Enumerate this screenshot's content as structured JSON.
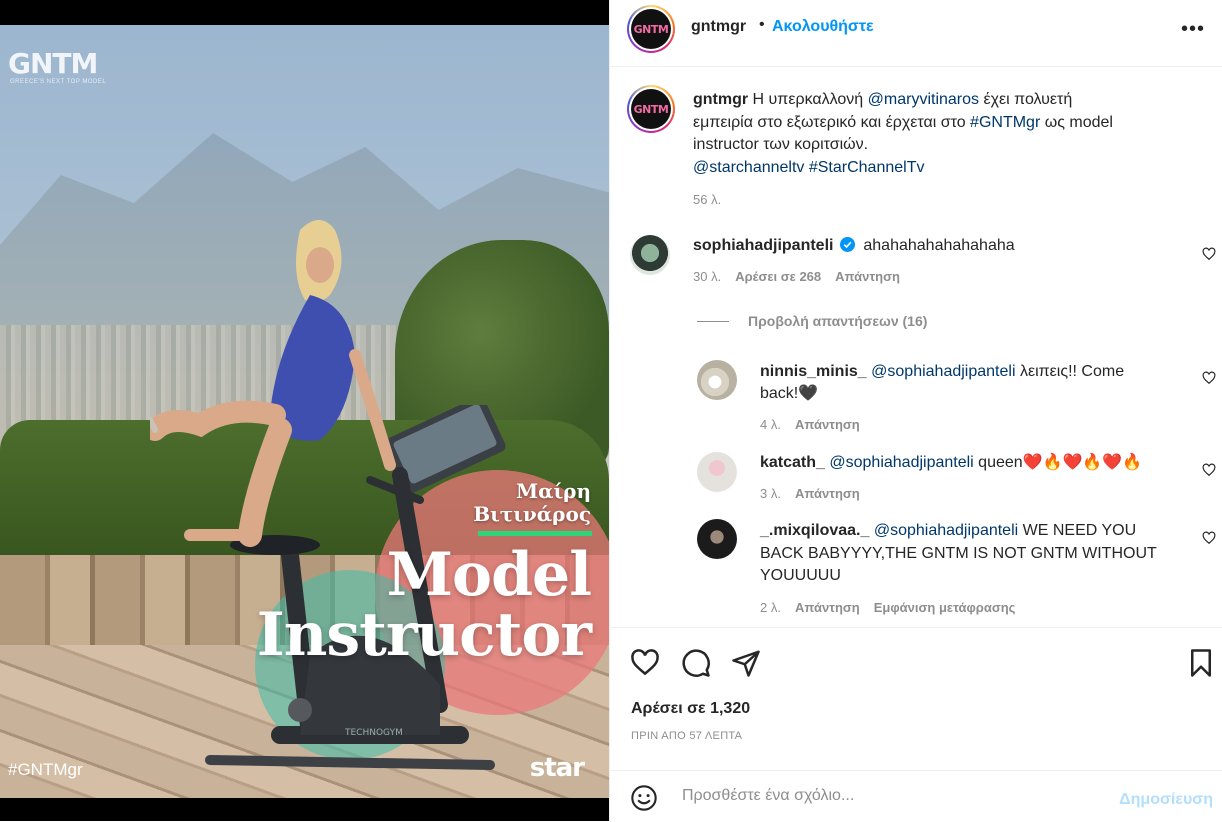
{
  "media": {
    "logo_text": "GNTM",
    "logo_subtext": "GREECE'S NEXT TOP MODEL",
    "person_name_line1": "Μαίρη",
    "person_name_line2": "Βιτινάρος",
    "title_line1": "Model",
    "title_line2": "Instructor",
    "hashtag": "#GNTMgr",
    "channel_logo": "star"
  },
  "header": {
    "avatar_text": "GNTM",
    "username": "gntmgr",
    "dot": "•",
    "follow_label": "Ακολουθήστε",
    "more_label": "•••"
  },
  "caption": {
    "username": "gntmgr",
    "text_1": " Η υπερκαλλονή ",
    "mention_1": "@maryvitinaros",
    "text_2": " έχει πολυετή εμπειρία στο εξωτερικό και έρχεται στο ",
    "hashtag_1": "#GNTMgr",
    "text_3": " ως model instructor των κοριτσιών.",
    "mention_2": "@starchanneltv",
    "hashtag_2": "#StarChannelTv",
    "time": "56 λ."
  },
  "comments": [
    {
      "username": "sophiahadjipanteli",
      "text": "ahahahahahahahaha",
      "time": "30 λ.",
      "likes": "Αρέσει σε 268",
      "reply": "Απάντηση",
      "view_replies": "Προβολή απαντήσεων (16)"
    },
    {
      "username": "ninnis_minis_",
      "mention": "@sophiahadjipanteli",
      "text_line1": " λειπεις!! Come",
      "text_line2": "back!🖤",
      "time": "4 λ.",
      "reply": "Απάντηση"
    },
    {
      "username": "katcath_",
      "mention": "@sophiahadjipanteli",
      "text": " queen❤️🔥❤️🔥❤️🔥",
      "time": "3 λ.",
      "reply": "Απάντηση"
    },
    {
      "username": "_.mixqilovaa._",
      "mention": "@sophiahadjipanteli",
      "text_line1": " WE NEED YOU",
      "text_line2": "BACK BABYYYY,THE GNTM IS NOT GNTM WITHOUT",
      "text_line3": "YOUUUUU",
      "time": "2 λ.",
      "reply": "Απάντηση",
      "translate": "Εμφάνιση μετάφρασης"
    }
  ],
  "footer": {
    "likes": "Αρέσει σε 1,320",
    "time_ago": "ΠΡΙΝ ΑΠΟ 57 ΛΕΠΤΑ",
    "comment_placeholder": "Προσθέστε ένα σχόλιο...",
    "publish_label": "Δημοσίευση"
  },
  "colors": {
    "accent_blue": "#0095f6",
    "link_blue": "#00376b",
    "muted": "#8e8e8e",
    "verified": "#0095f6"
  }
}
